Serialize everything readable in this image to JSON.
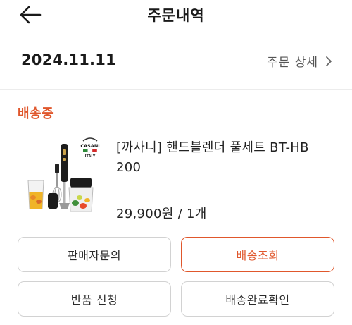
{
  "header": {
    "title": "주문내역",
    "back_icon": "arrow-left-icon"
  },
  "order": {
    "date": "2024.11.11",
    "detail_label": "주문 상세",
    "detail_icon": "chevron-right-icon",
    "status": "배송중",
    "product": {
      "name": "[까사니] 핸드블렌더 풀세트 BT-HB 200",
      "price": "29,900원 / 1개",
      "brand_logo_text": "CASANI",
      "brand_logo_sub": "ITALY"
    }
  },
  "actions": {
    "seller_inquiry": "판매자문의",
    "track_delivery": "배송조회",
    "return_request": "반품 신청",
    "confirm_delivery": "배송완료확인"
  },
  "colors": {
    "accent": "#e0572c",
    "border": "#d2d2d2"
  }
}
